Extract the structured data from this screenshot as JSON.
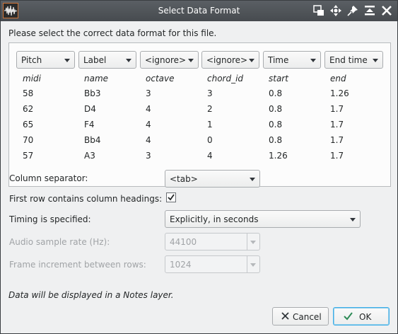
{
  "window": {
    "title": "Select Data Format"
  },
  "dialog": {
    "prompt": "Please select the correct data format for this file.",
    "columns": [
      {
        "role": "Pitch",
        "header": "midi"
      },
      {
        "role": "Label",
        "header": "name"
      },
      {
        "role": "<ignore>",
        "header": "octave"
      },
      {
        "role": "<ignore>",
        "header": "chord_id"
      },
      {
        "role": "Time",
        "header": "start"
      },
      {
        "role": "End time",
        "header": "end"
      }
    ],
    "rows": [
      [
        "58",
        "Bb3",
        "3",
        "3",
        "0.8",
        "1.26"
      ],
      [
        "62",
        "D4",
        "4",
        "2",
        "0.8",
        "1.7"
      ],
      [
        "65",
        "F4",
        "4",
        "1",
        "0.8",
        "1.7"
      ],
      [
        "70",
        "Bb4",
        "4",
        "0",
        "0.8",
        "1.7"
      ],
      [
        "57",
        "A3",
        "3",
        "4",
        "1.26",
        "1.7"
      ]
    ],
    "column_separator_label": "Column separator:",
    "column_separator_value": "<tab>",
    "first_row_label": "First row contains column headings:",
    "first_row_checked": true,
    "timing_label": "Timing is specified:",
    "timing_value": "Explicitly, in seconds",
    "sample_rate_label": "Audio sample rate (Hz):",
    "sample_rate_value": "44100",
    "frame_increment_label": "Frame increment between rows:",
    "frame_increment_value": "1024",
    "note": "Data will be displayed in a Notes layer.",
    "cancel_label": "Cancel",
    "ok_label": "OK"
  },
  "icons": {
    "app": "waveform-icon",
    "titlebar": [
      "window-layout-icon",
      "move-icon",
      "pin-icon",
      "shade-icon",
      "close-icon"
    ]
  },
  "colors": {
    "titlebar": "#4d5256",
    "accent": "#3daee9",
    "ok_check": "#2e8b57",
    "cancel_x": "#31363b"
  }
}
